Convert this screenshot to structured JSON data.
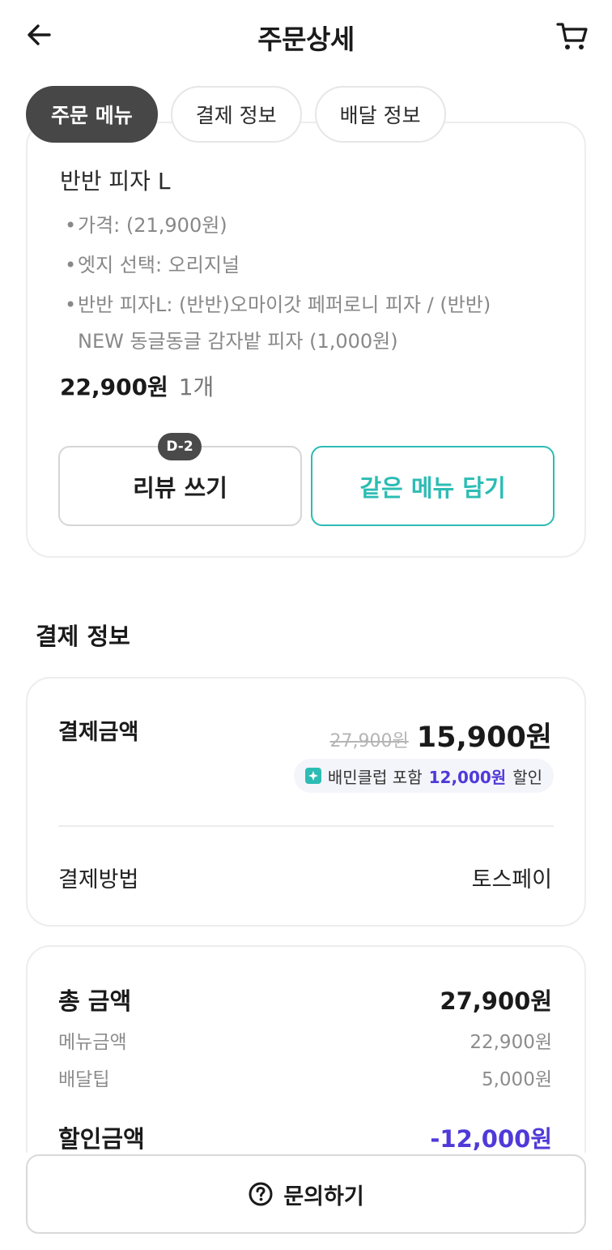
{
  "header": {
    "title": "주문상세"
  },
  "tabs": [
    {
      "label": "주문 메뉴",
      "active": true
    },
    {
      "label": "결제 정보",
      "active": false
    },
    {
      "label": "배달 정보",
      "active": false
    }
  ],
  "order_item": {
    "name": "반반 피자 L",
    "options": [
      "가격: (21,900원)",
      "엣지 선택: 오리지널",
      "반반 피자L: (반반)오마이갓 페퍼로니 피자 / (반반)",
      "NEW 동글동글 감자밭 피자 (1,000원)"
    ],
    "price": "22,900원",
    "quantity": "1개",
    "review_badge": "D-2",
    "review_button": "리뷰 쓰기",
    "reorder_button": "같은 메뉴 담기"
  },
  "payment_section": {
    "title": "결제 정보",
    "amount_label": "결제금액",
    "original_price": "27,900원",
    "final_price": "15,900원",
    "club_text_prefix": "배민클럽 포함",
    "club_discount": "12,000원",
    "club_text_suffix": "할인",
    "method_label": "결제방법",
    "method_value": "토스페이"
  },
  "totals": {
    "total_label": "총 금액",
    "total_value": "27,900원",
    "menu_label": "메뉴금액",
    "menu_value": "22,900원",
    "delivery_label": "배달팁",
    "delivery_value": "5,000원",
    "discount_label": "할인금액",
    "discount_value": "-12,000원"
  },
  "bottom": {
    "inquiry_label": "문의하기"
  },
  "colors": {
    "accent_teal": "#2dbcb4",
    "discount_purple": "#4f3ad8",
    "tab_active": "#474747"
  },
  "icons": {
    "back": "arrow-left-icon",
    "cart": "cart-icon",
    "inquiry": "question-circle-icon",
    "club": "baemin-club-icon"
  }
}
